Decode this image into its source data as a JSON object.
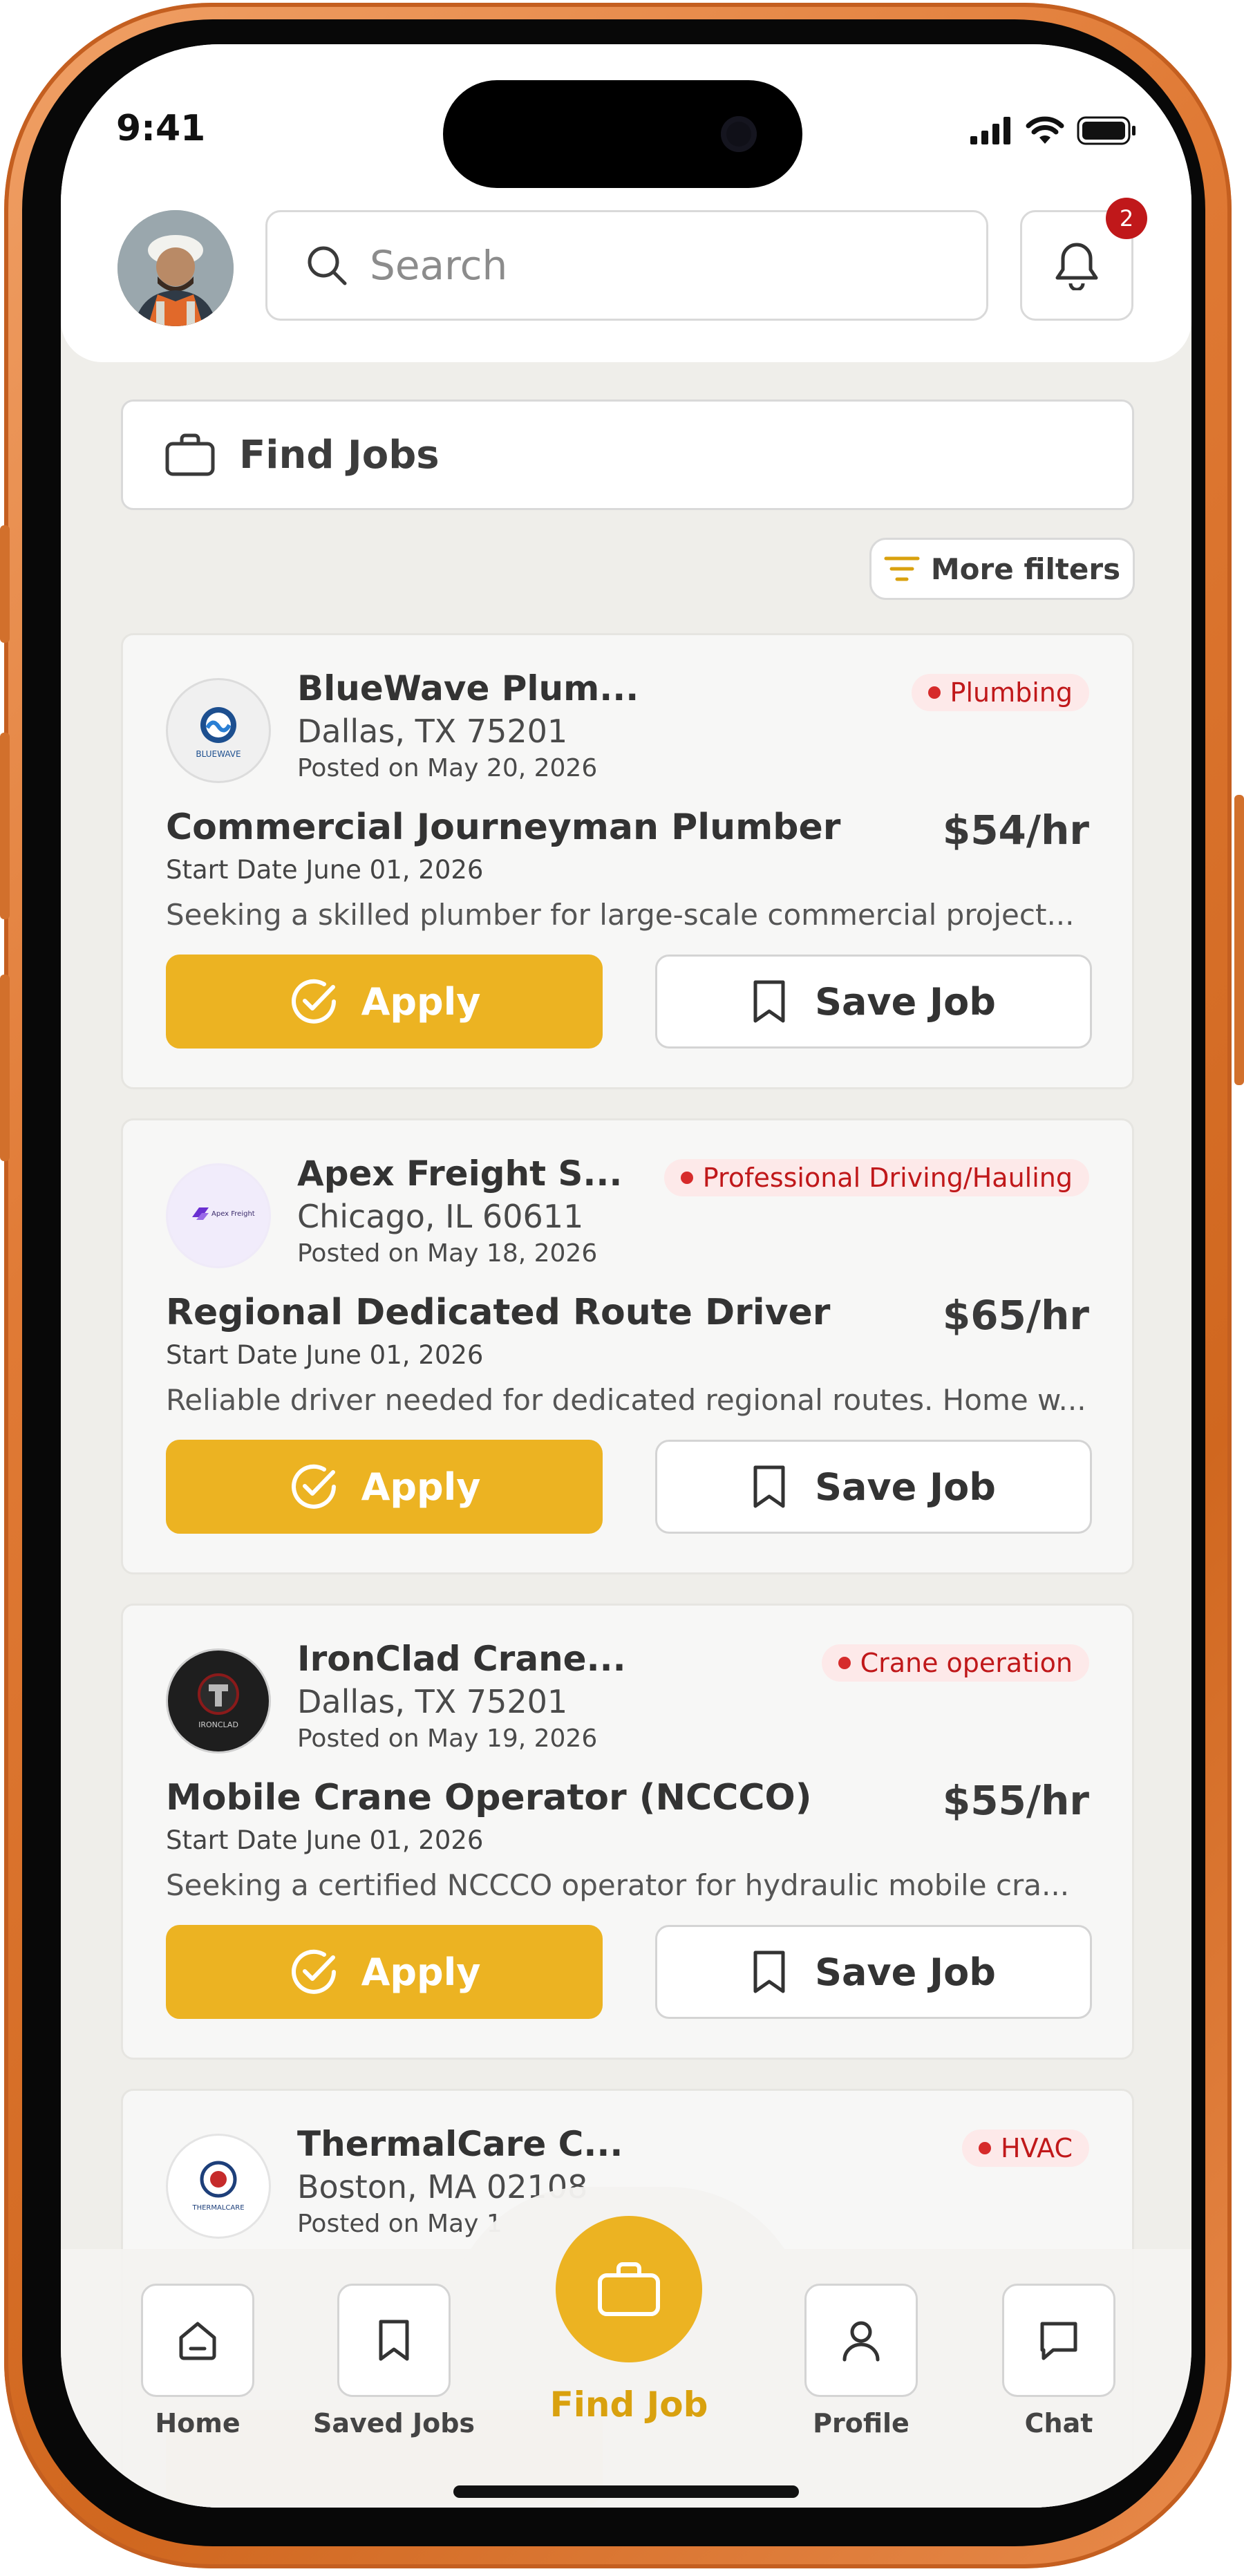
{
  "status_bar": {
    "time": "9:41"
  },
  "header": {
    "search_placeholder": "Search",
    "notification_count": "2"
  },
  "page": {
    "title": "Find Jobs",
    "filters_label": "More filters"
  },
  "jobs": [
    {
      "company": "BlueWave Plum...",
      "logo_text": "BLUEWAVE",
      "location": "Dallas, TX 75201",
      "posted": "Posted on May 20, 2026",
      "tag": "Plumbing",
      "title": "Commercial Journeyman Plumber",
      "rate": "$54/hr",
      "start": "Start Date  June 01, 2026",
      "description": "Seeking a skilled plumber for large-scale commercial project...",
      "apply_label": "Apply",
      "save_label": "Save Job"
    },
    {
      "company": "Apex Freight S...",
      "logo_text": "Apex Freight",
      "location": "Chicago, IL 60611",
      "posted": "Posted on May 18, 2026",
      "tag": "Professional Driving/Hauling",
      "title": "Regional Dedicated Route Driver",
      "rate": "$65/hr",
      "start": "Start Date  June 01, 2026",
      "description": "Reliable driver needed for dedicated regional routes. Home w...",
      "apply_label": "Apply",
      "save_label": "Save Job"
    },
    {
      "company": "IronClad Crane...",
      "logo_text": "IRONCLAD",
      "location": "Dallas, TX 75201",
      "posted": "Posted on May 19, 2026",
      "tag": "Crane operation",
      "title": "Mobile Crane Operator (NCCCO)",
      "rate": "$55/hr",
      "start": "Start Date  June 01, 2026",
      "description": "Seeking a certified NCCCO operator for hydraulic mobile cra...",
      "apply_label": "Apply",
      "save_label": "Save Job"
    },
    {
      "company": "ThermalCare C...",
      "logo_text": "THERMALCARE",
      "location": "Boston, MA 02108",
      "posted": "Posted on May 1",
      "tag": "HVAC"
    }
  ],
  "nav": {
    "home": "Home",
    "saved": "Saved Jobs",
    "find": "Find Job",
    "profile": "Profile",
    "chat": "Chat"
  },
  "colors": {
    "accent": "#ecb322",
    "tag_red": "#c0181a",
    "frame_orange": "#e07a35"
  }
}
